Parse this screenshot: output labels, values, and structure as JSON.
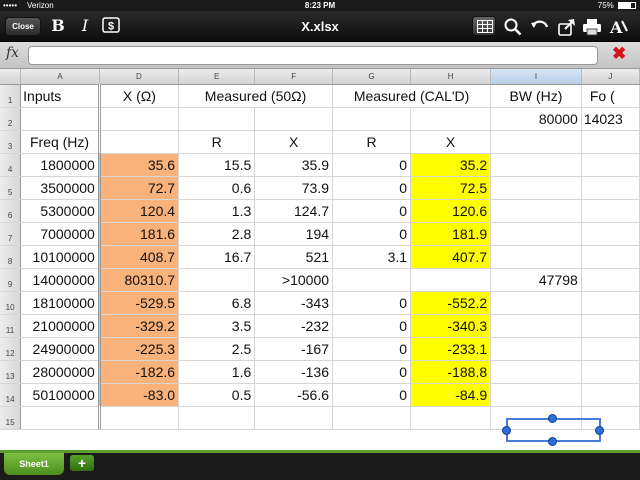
{
  "status_bar": {
    "signal": "•••••",
    "carrier": "Verizon",
    "time": "8:23 PM",
    "battery": "75%",
    "battery_level": 0.75
  },
  "toolbar": {
    "close_label": "Close",
    "bold_label": "B",
    "italic_label": "I",
    "currency_label": "$",
    "title": "X.xlsx"
  },
  "formula_bar": {
    "fx_label": "fx",
    "value": ""
  },
  "sheet": {
    "columns": [
      "A",
      "D",
      "E",
      "F",
      "G",
      "H",
      "I",
      "J"
    ],
    "rows": [
      "1",
      "2",
      "3",
      "4",
      "5",
      "6",
      "7",
      "8",
      "9",
      "10",
      "11",
      "12",
      "13",
      "14",
      "15"
    ],
    "headers": {
      "inputs": "Inputs",
      "x_ohm": "X (Ω)",
      "measured_50": "Measured (50Ω)",
      "measured_cal": "Measured (CAL'D)",
      "bw": "BW (Hz)",
      "fo": "Fo (",
      "bw_value": "80000",
      "fo_value": "14023",
      "freq": "Freq (Hz)",
      "r1": "R",
      "x1": "X",
      "r2": "R",
      "x2": "X"
    },
    "data": [
      {
        "freq": "1800000",
        "x": "35.6",
        "r50": "15.5",
        "x50": "35.9",
        "rcal": "0",
        "xcal": "35.2",
        "bw": ""
      },
      {
        "freq": "3500000",
        "x": "72.7",
        "r50": "0.6",
        "x50": "73.9",
        "rcal": "0",
        "xcal": "72.5",
        "bw": ""
      },
      {
        "freq": "5300000",
        "x": "120.4",
        "r50": "1.3",
        "x50": "124.7",
        "rcal": "0",
        "xcal": "120.6",
        "bw": ""
      },
      {
        "freq": "7000000",
        "x": "181.6",
        "r50": "2.8",
        "x50": "194",
        "rcal": "0",
        "xcal": "181.9",
        "bw": ""
      },
      {
        "freq": "10100000",
        "x": "408.7",
        "r50": "16.7",
        "x50": "521",
        "rcal": "3.1",
        "xcal": "407.7",
        "bw": ""
      },
      {
        "freq": "14000000",
        "x": "80310.7",
        "r50": "",
        "x50": ">10000",
        "rcal": "",
        "xcal": "",
        "bw": "47798"
      },
      {
        "freq": "18100000",
        "x": "-529.5",
        "r50": "6.8",
        "x50": "-343",
        "rcal": "0",
        "xcal": "-552.2",
        "bw": ""
      },
      {
        "freq": "21000000",
        "x": "-329.2",
        "r50": "3.5",
        "x50": "-232",
        "rcal": "0",
        "xcal": "-340.3",
        "bw": ""
      },
      {
        "freq": "24900000",
        "x": "-225.3",
        "r50": "2.5",
        "x50": "-167",
        "rcal": "0",
        "xcal": "-233.1",
        "bw": ""
      },
      {
        "freq": "28000000",
        "x": "-182.6",
        "r50": "1.6",
        "x50": "-136",
        "rcal": "0",
        "xcal": "-188.8",
        "bw": ""
      },
      {
        "freq": "50100000",
        "x": "-83.0",
        "r50": "0.5",
        "x50": "-56.6",
        "rcal": "0",
        "xcal": "-84.9",
        "bw": ""
      }
    ],
    "fill_colors": {
      "x_column": "#f9b27a",
      "cal_x_column": "#ffff00"
    }
  },
  "tabs": {
    "sheet_label": "Sheet1",
    "add_label": "+"
  }
}
